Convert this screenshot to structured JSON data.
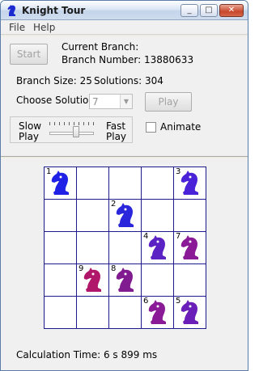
{
  "window": {
    "title": "Knight Tour"
  },
  "titlebar": {
    "minimize": "_",
    "maximize": "□",
    "close": "✕"
  },
  "menu": {
    "file": "File",
    "help": "Help"
  },
  "controls": {
    "start_label": "Start",
    "current_branch_label": "Current Branch:",
    "branch_number_label": "Branch Number: 13880633",
    "branch_size_label": "Branch Size: 25",
    "solutions_label": "Solutions: 304",
    "choose_solution_label": "Choose Solution",
    "solution_value": "7",
    "play_label": "Play",
    "slow_label_1": "Slow",
    "slow_label_2": "Play",
    "fast_label_1": "Fast",
    "fast_label_2": "Play",
    "animate_label": "Animate",
    "animate_checked": false,
    "speed_level_fraction": 0.55
  },
  "board": {
    "rows": 5,
    "cols": 5,
    "pieces": [
      {
        "row": 0,
        "col": 0,
        "number": "1",
        "color": "#1f22e6"
      },
      {
        "row": 0,
        "col": 4,
        "number": "3",
        "color": "#4a22d8"
      },
      {
        "row": 1,
        "col": 2,
        "number": "2",
        "color": "#2a26dc"
      },
      {
        "row": 2,
        "col": 3,
        "number": "4",
        "color": "#5b22c4"
      },
      {
        "row": 2,
        "col": 4,
        "number": "7",
        "color": "#8a1a96"
      },
      {
        "row": 3,
        "col": 1,
        "number": "9",
        "color": "#b0176a"
      },
      {
        "row": 3,
        "col": 2,
        "number": "8",
        "color": "#801c8f"
      },
      {
        "row": 4,
        "col": 3,
        "number": "6",
        "color": "#8a1a96"
      },
      {
        "row": 4,
        "col": 4,
        "number": "5",
        "color": "#6a20b8"
      }
    ]
  },
  "status": {
    "calculation_time": "Calculation Time: 6 s 899 ms"
  }
}
